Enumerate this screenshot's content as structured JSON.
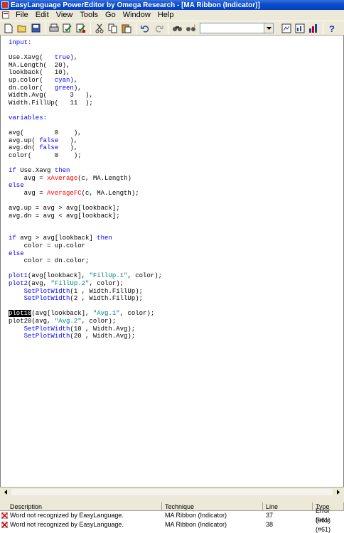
{
  "window": {
    "title": "EasyLanguage PowerEditor by Omega Research - [MA Ribbon (Indicator)]"
  },
  "menu": [
    "File",
    "Edit",
    "View",
    "Tools",
    "Go",
    "Window",
    "Help"
  ],
  "toolbar": {
    "combo_value": "",
    "icons": [
      "new-file-icon",
      "open-folder-icon",
      "save-icon",
      "print-icon",
      "verify-icon",
      "verify-all-icon",
      "cut-icon",
      "copy-icon",
      "paste-icon",
      "undo-icon",
      "redo-icon",
      "find-icon",
      "find-next-icon",
      "dictionary-icon",
      "chart-icon",
      "bar-chart-icon",
      "help-icon"
    ]
  },
  "code_lines": [
    [
      {
        "t": "input:",
        "c": "kw"
      }
    ],
    [],
    [
      {
        "t": "Use.Xavg(   "
      },
      {
        "t": "true",
        "c": "kw"
      },
      {
        "t": "),"
      }
    ],
    [
      {
        "t": "MA.Length(  20),"
      }
    ],
    [
      {
        "t": "lookback(   10),"
      }
    ],
    [
      {
        "t": "up.color(   "
      },
      {
        "t": "cyan",
        "c": "kw"
      },
      {
        "t": "),"
      }
    ],
    [
      {
        "t": "dn.color(   "
      },
      {
        "t": "green",
        "c": "kw"
      },
      {
        "t": "),"
      }
    ],
    [
      {
        "t": "Width.Avg(      3   ),"
      }
    ],
    [
      {
        "t": "Width.FillUp(   11  );"
      }
    ],
    [],
    [
      {
        "t": "variables:",
        "c": "kw"
      }
    ],
    [],
    [
      {
        "t": "avg(        0    ),"
      }
    ],
    [
      {
        "t": "avg.up( "
      },
      {
        "t": "false",
        "c": "kw"
      },
      {
        "t": "   ),"
      }
    ],
    [
      {
        "t": "avg.dn( "
      },
      {
        "t": "false",
        "c": "kw"
      },
      {
        "t": "   ),"
      }
    ],
    [
      {
        "t": "color(      0    );"
      }
    ],
    [],
    [
      {
        "t": "if",
        "c": "kw"
      },
      {
        "t": " Use.Xavg "
      },
      {
        "t": "then",
        "c": "kw"
      }
    ],
    [
      {
        "t": "    avg = "
      },
      {
        "t": "xAverage",
        "c": "fn"
      },
      {
        "t": "(c, MA.Length)"
      }
    ],
    [
      {
        "t": "else",
        "c": "kw"
      }
    ],
    [
      {
        "t": "    avg = "
      },
      {
        "t": "AverageFC",
        "c": "fn"
      },
      {
        "t": "(c, MA.Length);"
      }
    ],
    [],
    [
      {
        "t": "avg.up = avg > avg[lookback];"
      }
    ],
    [
      {
        "t": "avg.dn = avg < avg[lookback];"
      }
    ],
    [],
    [],
    [
      {
        "t": "if",
        "c": "kw"
      },
      {
        "t": " avg > avg[lookback] "
      },
      {
        "t": "then",
        "c": "kw"
      }
    ],
    [
      {
        "t": "    color = up.color"
      }
    ],
    [
      {
        "t": "else",
        "c": "kw"
      }
    ],
    [
      {
        "t": "    color = dn.color;"
      }
    ],
    [],
    [
      {
        "t": "plot1",
        "c": "kw"
      },
      {
        "t": "(avg[lookback], "
      },
      {
        "t": "\"FillUp.1\"",
        "c": "str"
      },
      {
        "t": ", color);"
      }
    ],
    [
      {
        "t": "plot2",
        "c": "kw"
      },
      {
        "t": "(avg, "
      },
      {
        "t": "\"FillUp.2\"",
        "c": "str"
      },
      {
        "t": ", color);"
      }
    ],
    [
      {
        "t": "    "
      },
      {
        "t": "SetPlotWidth",
        "c": "kw"
      },
      {
        "t": "(1 , Width.FillUp);"
      }
    ],
    [
      {
        "t": "    "
      },
      {
        "t": "SetPlotWidth",
        "c": "kw"
      },
      {
        "t": "(2 , Width.FillUp);"
      }
    ],
    [],
    [
      {
        "t": "plot10",
        "c": "hl"
      },
      {
        "t": "(avg[lookback], "
      },
      {
        "t": "\"Avg.1\"",
        "c": "str"
      },
      {
        "t": ", color);"
      }
    ],
    [
      {
        "t": "plot20(avg, "
      },
      {
        "t": "\"Avg.2\"",
        "c": "str"
      },
      {
        "t": ", color);"
      }
    ],
    [
      {
        "t": "    "
      },
      {
        "t": "SetPlotWidth",
        "c": "kw"
      },
      {
        "t": "(10 , Width.Avg);"
      }
    ],
    [
      {
        "t": "    "
      },
      {
        "t": "SetPlotWidth",
        "c": "kw"
      },
      {
        "t": "(20 , Width.Avg);"
      }
    ]
  ],
  "errors": {
    "headers": [
      "Description",
      "Technique",
      "Line",
      "Type"
    ],
    "rows": [
      {
        "description": "Word not recognized by EasyLanguage.",
        "technique": "MA Ribbon (Indicator)",
        "line": "37",
        "type": "Error (#61)"
      },
      {
        "description": "Word not recognized by EasyLanguage.",
        "technique": "MA Ribbon (Indicator)",
        "line": "38",
        "type": "Error (#61)"
      }
    ]
  }
}
